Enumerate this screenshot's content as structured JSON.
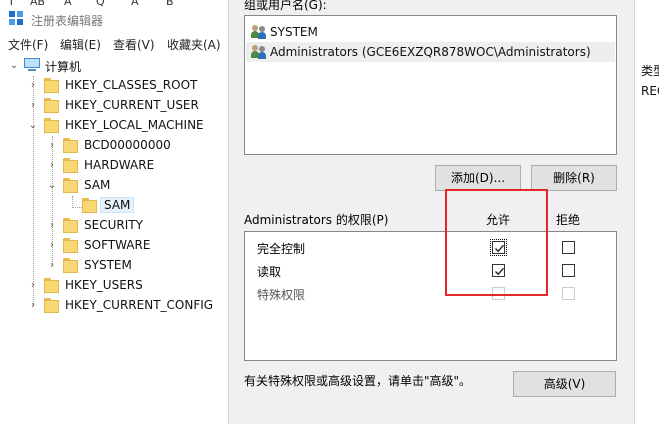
{
  "regedit": {
    "top_clip": [
      "T",
      "AB",
      "A",
      "Q",
      "A",
      "B"
    ],
    "title": "注册表编辑器",
    "menu": [
      "文件(F)",
      "编辑(E)",
      "查看(V)",
      "收藏夹(A)"
    ],
    "tree": {
      "computer": "计算机",
      "hkcr": "HKEY_CLASSES_ROOT",
      "hkcu": "HKEY_CURRENT_USER",
      "hklm": "HKEY_LOCAL_MACHINE",
      "bcd": "BCD00000000",
      "hardware": "HARDWARE",
      "sam": "SAM",
      "sam_child": "SAM",
      "security": "SECURITY",
      "software": "SOFTWARE",
      "system": "SYSTEM",
      "hku": "HKEY_USERS",
      "hkcc": "HKEY_CURRENT_CONFIG"
    }
  },
  "dialog": {
    "users_label": "组或用户名(G):",
    "users": [
      "SYSTEM",
      "Administrators (GCE6EXZQR878WOC\\Administrators)"
    ],
    "add_label": "添加(D)...",
    "remove_label": "删除(R)",
    "permissions_label": "Administrators 的权限(P)",
    "allow_label": "允许",
    "deny_label": "拒绝",
    "permissions": [
      {
        "name": "完全控制",
        "allow": true,
        "deny": false,
        "enabled": true
      },
      {
        "name": "读取",
        "allow": true,
        "deny": false,
        "enabled": true
      },
      {
        "name": "特殊权限",
        "allow": false,
        "deny": false,
        "enabled": false
      }
    ],
    "hint": "有关特殊权限或高级设置，请单击\"高级\"。",
    "advanced_label": "高级(V)"
  },
  "right_window": {
    "header": "类型",
    "row": "REG"
  },
  "colors": {
    "highlight_box": "#e3262c",
    "folder": "#f8d775",
    "selection": "#e5f1fb"
  }
}
